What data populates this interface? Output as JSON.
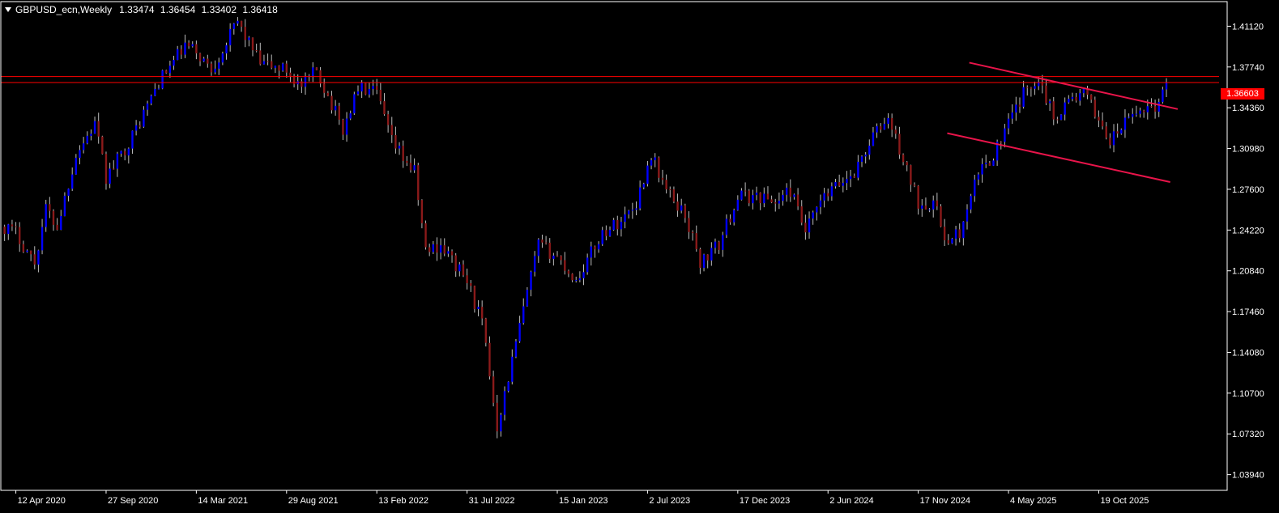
{
  "header": {
    "symbol_label": "GBPUSD_ecn,Weekly",
    "open": "1.33474",
    "high": "1.36454",
    "low": "1.33402",
    "close": "1.36418"
  },
  "current_price_label": "1.36603",
  "colors": {
    "background": "#000000",
    "bull": "#0000ff",
    "bear": "#8b1a1a",
    "wick": "#bbbbbb",
    "axis": "#ffffff",
    "hline": "#ff0000",
    "trendline": "#e8144a",
    "price_tag": "#ff0000"
  },
  "chart_data": {
    "type": "candlestick",
    "title": "GBPUSD_ecn,Weekly",
    "grid": false,
    "ylim": [
      1.0264,
      1.4316
    ],
    "y_ticks": [
      "1.41120",
      "1.37740",
      "1.34360",
      "1.30980",
      "1.27600",
      "1.24220",
      "1.20840",
      "1.17460",
      "1.14080",
      "1.10700",
      "1.07320",
      "1.03940"
    ],
    "x_ticks": [
      "12 Apr 2020",
      "27 Sep 2020",
      "14 Mar 2021",
      "29 Aug 2021",
      "13 Feb 2022",
      "31 Jul 2022",
      "15 Jan 2023",
      "2 Jul 2023",
      "17 Dec 2023",
      "2 Jun 2024",
      "17 Nov 2024",
      "4 May 2025",
      "19 Oct 2025"
    ],
    "horizontal_lines": [
      1.3695,
      1.3645
    ],
    "trendlines": [
      {
        "from": [
          "2025-02-20",
          1.381
        ],
        "to": [
          "2026-03-15",
          1.3425
        ]
      },
      {
        "from": [
          "2025-01-10",
          1.3225
        ],
        "to": [
          "2026-03-01",
          1.282
        ]
      }
    ],
    "path_points": [
      [
        "2020-03-22",
        1.245
      ],
      [
        "2020-04-12",
        1.24
      ],
      [
        "2020-05-17",
        1.215
      ],
      [
        "2020-06-07",
        1.26
      ],
      [
        "2020-06-28",
        1.245
      ],
      [
        "2020-08-02",
        1.305
      ],
      [
        "2020-09-06",
        1.33
      ],
      [
        "2020-09-27",
        1.285
      ],
      [
        "2020-11-15",
        1.32
      ],
      [
        "2021-01-03",
        1.365
      ],
      [
        "2021-02-21",
        1.395
      ],
      [
        "2021-03-14",
        1.39
      ],
      [
        "2021-04-11",
        1.375
      ],
      [
        "2021-05-30",
        1.415
      ],
      [
        "2021-07-11",
        1.38
      ],
      [
        "2021-08-29",
        1.375
      ],
      [
        "2021-09-26",
        1.36
      ],
      [
        "2021-10-24",
        1.375
      ],
      [
        "2021-12-12",
        1.325
      ],
      [
        "2022-01-09",
        1.36
      ],
      [
        "2022-02-13",
        1.355
      ],
      [
        "2022-03-13",
        1.315
      ],
      [
        "2022-04-24",
        1.29
      ],
      [
        "2022-05-15",
        1.225
      ],
      [
        "2022-06-12",
        1.23
      ],
      [
        "2022-07-31",
        1.2
      ],
      [
        "2022-08-28",
        1.165
      ],
      [
        "2022-09-25",
        1.08
      ],
      [
        "2022-10-16",
        1.12
      ],
      [
        "2022-11-20",
        1.19
      ],
      [
        "2022-12-11",
        1.23
      ],
      [
        "2023-01-15",
        1.22
      ],
      [
        "2023-02-19",
        1.2
      ],
      [
        "2023-04-09",
        1.24
      ],
      [
        "2023-05-14",
        1.25
      ],
      [
        "2023-06-11",
        1.265
      ],
      [
        "2023-07-09",
        1.305
      ],
      [
        "2023-08-06",
        1.275
      ],
      [
        "2023-09-10",
        1.255
      ],
      [
        "2023-10-08",
        1.215
      ],
      [
        "2023-11-12",
        1.23
      ],
      [
        "2023-12-17",
        1.27
      ],
      [
        "2024-01-28",
        1.27
      ],
      [
        "2024-02-25",
        1.265
      ],
      [
        "2024-03-24",
        1.275
      ],
      [
        "2024-04-21",
        1.24
      ],
      [
        "2024-05-19",
        1.265
      ],
      [
        "2024-06-09",
        1.275
      ],
      [
        "2024-07-21",
        1.29
      ],
      [
        "2024-08-25",
        1.32
      ],
      [
        "2024-09-22",
        1.335
      ],
      [
        "2024-10-20",
        1.3
      ],
      [
        "2024-11-17",
        1.265
      ],
      [
        "2024-12-15",
        1.265
      ],
      [
        "2025-01-12",
        1.23
      ],
      [
        "2025-02-09",
        1.245
      ],
      [
        "2025-03-09",
        1.29
      ],
      [
        "2025-04-06",
        1.305
      ],
      [
        "2025-05-04",
        1.33
      ],
      [
        "2025-06-01",
        1.355
      ],
      [
        "2025-06-29",
        1.37
      ],
      [
        "2025-07-27",
        1.335
      ],
      [
        "2025-08-24",
        1.35
      ],
      [
        "2025-09-21",
        1.355
      ],
      [
        "2025-10-19",
        1.335
      ],
      [
        "2025-11-09",
        1.315
      ],
      [
        "2025-12-14",
        1.335
      ],
      [
        "2026-01-18",
        1.345
      ],
      [
        "2026-02-08",
        1.345
      ],
      [
        "2026-02-22",
        1.3642
      ]
    ]
  }
}
